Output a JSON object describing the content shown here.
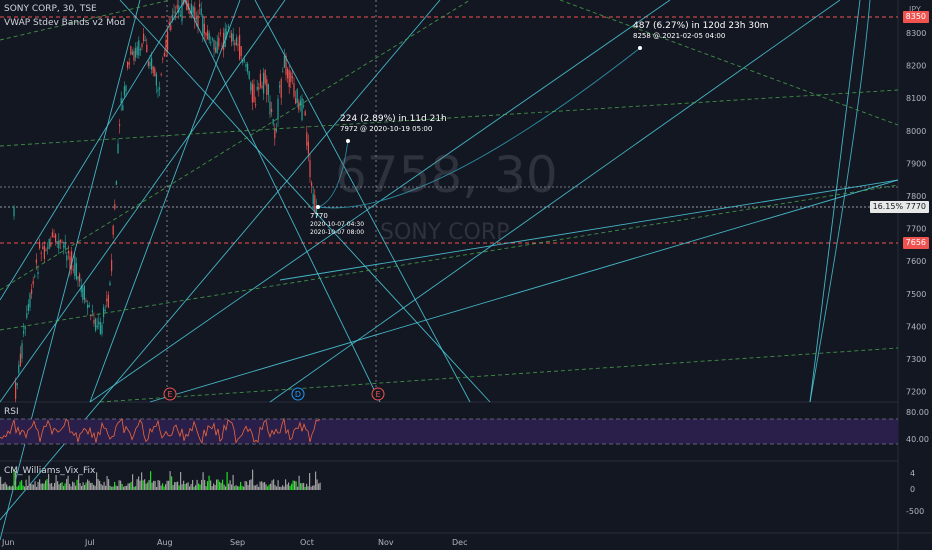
{
  "header": {
    "title": "SONY CORP, 30, TSE",
    "indicator": "VWAP Stdev Bands v2 Mod",
    "currency": "JPY"
  },
  "watermark": {
    "symbol": "6758, 30",
    "name": "SONY CORP"
  },
  "price_scale": {
    "ticks": [
      "8300",
      "8200",
      "8100",
      "8000",
      "7900",
      "7800",
      "7700",
      "7600",
      "7500",
      "7400",
      "7300",
      "7200"
    ]
  },
  "price_tags": {
    "top": "8350",
    "current": "7770",
    "current_pct": "16.15%",
    "low": "7656"
  },
  "annotations": {
    "a1_title": "224 (2.89%) in 11d 21h",
    "a1_sub": "7972 @ 2020-10-19  05:00",
    "a2_title": "487 (6.27%) in 120d 23h 30m",
    "a2_sub": "8258 @ 2021-02-05  04:00",
    "low_price": "7770",
    "low_sub1": "2020-10-07 04:30",
    "low_sub2": "2020-10-07 08:00"
  },
  "markers": {
    "e1": "E",
    "d": "D",
    "e2": "E"
  },
  "rsi": {
    "label": "RSI",
    "ticks": [
      "80.00",
      "40.00"
    ]
  },
  "vix": {
    "label": "CM_Williams_Vix_Fix",
    "ticks": [
      "4",
      "0",
      "-500"
    ]
  },
  "time_axis": {
    "labels": [
      "Jun",
      "Jul",
      "Aug",
      "Sep",
      "Oct",
      "Nov",
      "Dec"
    ]
  },
  "colors": {
    "background": "#131722",
    "up": "#26a69a",
    "down": "#ef5350",
    "fib_line": "#4dd0e1",
    "trend_dashed": "#4caf50",
    "red_level": "#ef5350",
    "rsi_line": "#f0663a",
    "rsi_band": "#2a1f4a",
    "vix_green": "#22dd22",
    "vix_gray": "#9e9e9e"
  }
}
